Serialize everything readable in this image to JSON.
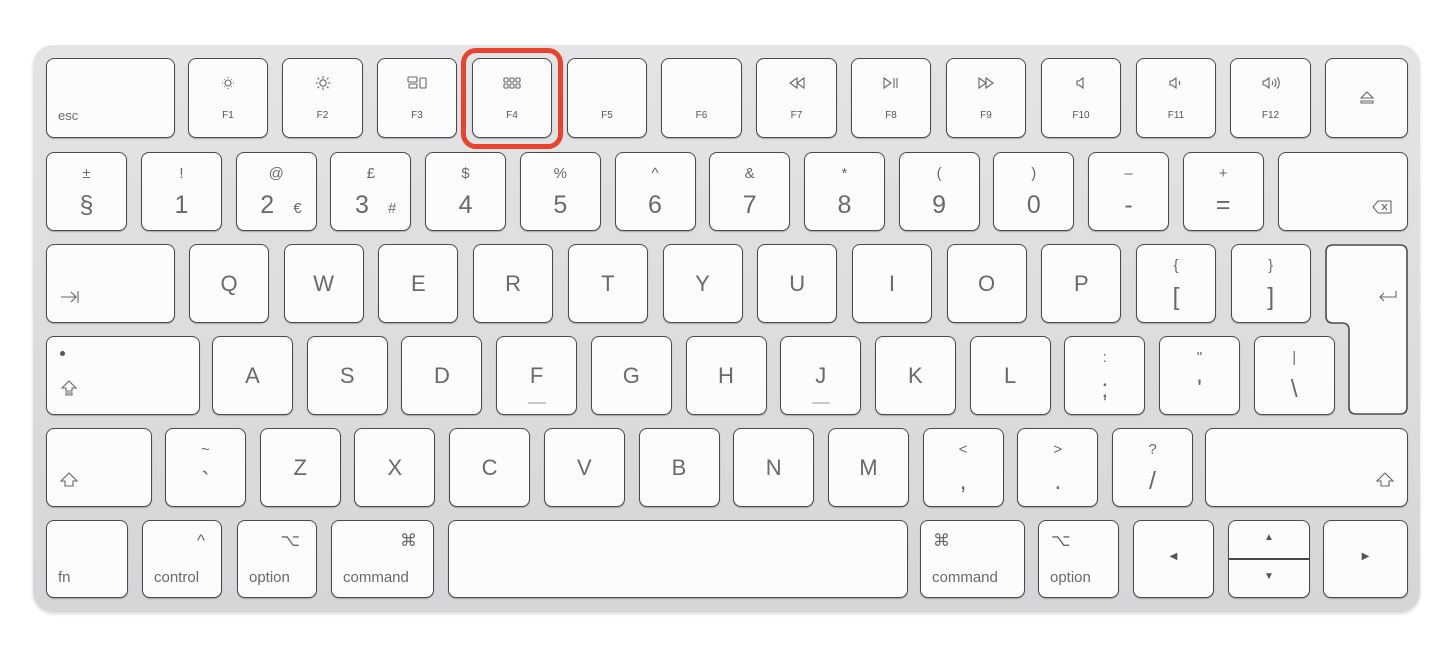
{
  "highlight": {
    "key": "F4",
    "color": "#e8432d"
  },
  "rows": [
    [
      {
        "label": "esc"
      },
      {
        "label": "F1",
        "icon": "brightness-down"
      },
      {
        "label": "F2",
        "icon": "brightness-up"
      },
      {
        "label": "F3",
        "icon": "mission-control"
      },
      {
        "label": "F4",
        "icon": "launchpad"
      },
      {
        "label": "F5"
      },
      {
        "label": "F6"
      },
      {
        "label": "F7",
        "icon": "rewind"
      },
      {
        "label": "F8",
        "icon": "play-pause"
      },
      {
        "label": "F9",
        "icon": "fast-forward"
      },
      {
        "label": "F10",
        "icon": "mute"
      },
      {
        "label": "F11",
        "icon": "volume-down"
      },
      {
        "label": "F12",
        "icon": "volume-up"
      },
      {
        "icon": "eject"
      }
    ],
    [
      {
        "top": "±",
        "main": "§"
      },
      {
        "top": "!",
        "main": "1"
      },
      {
        "top": "@",
        "main": "2",
        "side": "€"
      },
      {
        "top": "£",
        "main": "3",
        "side": "#"
      },
      {
        "top": "$",
        "main": "4"
      },
      {
        "top": "%",
        "main": "5"
      },
      {
        "top": "^",
        "main": "6"
      },
      {
        "top": "&",
        "main": "7"
      },
      {
        "top": "*",
        "main": "8"
      },
      {
        "top": "(",
        "main": "9"
      },
      {
        "top": ")",
        "main": "0"
      },
      {
        "top": "–",
        "main": "-"
      },
      {
        "top": "+",
        "main": "="
      },
      {
        "icon": "delete"
      }
    ],
    [
      {
        "icon": "tab"
      },
      {
        "letter": "Q"
      },
      {
        "letter": "W"
      },
      {
        "letter": "E"
      },
      {
        "letter": "R"
      },
      {
        "letter": "T"
      },
      {
        "letter": "Y"
      },
      {
        "letter": "U"
      },
      {
        "letter": "I"
      },
      {
        "letter": "O"
      },
      {
        "letter": "P"
      },
      {
        "top": "{",
        "main": "["
      },
      {
        "top": "}",
        "main": "]"
      },
      {
        "icon": "return"
      }
    ],
    [
      {
        "icon": "caps-lock"
      },
      {
        "letter": "A"
      },
      {
        "letter": "S"
      },
      {
        "letter": "D"
      },
      {
        "letter": "F"
      },
      {
        "letter": "G"
      },
      {
        "letter": "H"
      },
      {
        "letter": "J"
      },
      {
        "letter": "K"
      },
      {
        "letter": "L"
      },
      {
        "top": ":",
        "main": ";"
      },
      {
        "top": "\"",
        "main": "'"
      },
      {
        "top": "|",
        "main": "\\"
      }
    ],
    [
      {
        "icon": "shift"
      },
      {
        "top": "~",
        "main": "`"
      },
      {
        "letter": "Z"
      },
      {
        "letter": "X"
      },
      {
        "letter": "C"
      },
      {
        "letter": "V"
      },
      {
        "letter": "B"
      },
      {
        "letter": "N"
      },
      {
        "letter": "M"
      },
      {
        "top": "<",
        "main": ","
      },
      {
        "top": ">",
        "main": "."
      },
      {
        "top": "?",
        "main": "/"
      },
      {
        "icon": "shift"
      }
    ],
    [
      {
        "label": "fn"
      },
      {
        "label": "control",
        "symbol": "^"
      },
      {
        "label": "option",
        "symbol": "⌥"
      },
      {
        "label": "command",
        "symbol": "⌘"
      },
      {
        "name": "space"
      },
      {
        "label": "command",
        "symbol": "⌘"
      },
      {
        "label": "option",
        "symbol": "⌥"
      },
      {
        "icon": "arrow-left"
      },
      {
        "icon": "arrow-up"
      },
      {
        "icon": "arrow-down"
      },
      {
        "icon": "arrow-right"
      }
    ]
  ]
}
